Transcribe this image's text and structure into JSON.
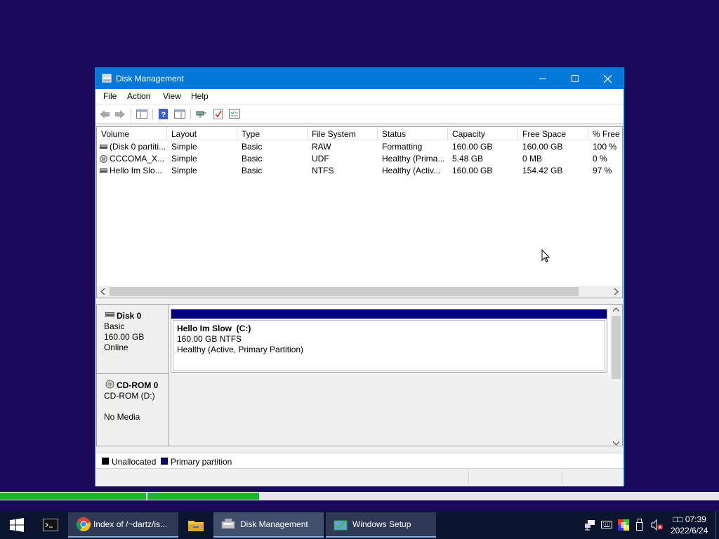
{
  "window": {
    "title": "Disk Management",
    "menu": [
      "File",
      "Action",
      "View",
      "Help"
    ]
  },
  "volume_list": {
    "columns": [
      "Volume",
      "Layout",
      "Type",
      "File System",
      "Status",
      "Capacity",
      "Free Space",
      "% Free"
    ],
    "rows": [
      [
        "(Disk 0 partiti...",
        "Simple",
        "Basic",
        "RAW",
        "Formatting",
        "160.00 GB",
        "160.00 GB",
        "100 %"
      ],
      [
        "CCCOMA_X...",
        "Simple",
        "Basic",
        "UDF",
        "Healthy (Prima...",
        "5.48 GB",
        "0 MB",
        "0 %"
      ],
      [
        "Hello Im Slo...",
        "Simple",
        "Basic",
        "NTFS",
        "Healthy (Activ...",
        "160.00 GB",
        "154.42 GB",
        "97 %"
      ]
    ]
  },
  "disks": [
    {
      "name": "Disk 0",
      "type": "Basic",
      "size": "160.00 GB",
      "state": "Online",
      "partition": {
        "label": "Hello Im Slow  (C:)",
        "size_fs": "160.00 GB NTFS",
        "status": "Healthy (Active, Primary Partition)"
      }
    },
    {
      "name": "CD-ROM 0",
      "type": "CD-ROM (D:)",
      "state": "No Media"
    }
  ],
  "legend": [
    "Unallocated",
    "Primary partition"
  ],
  "colors": {
    "desktop": "#1a0a5c",
    "titlebar": "#0078d7",
    "primary_partition": "#00007f",
    "progress": "#22b233"
  },
  "progress": {
    "fraction": 0.36
  },
  "taskbar": {
    "tasks": [
      "Index of /~dartz/is...",
      "Disk Management",
      "Windows Setup"
    ],
    "clock_time": "□□ 07:39",
    "clock_date": "2022/6/24"
  }
}
